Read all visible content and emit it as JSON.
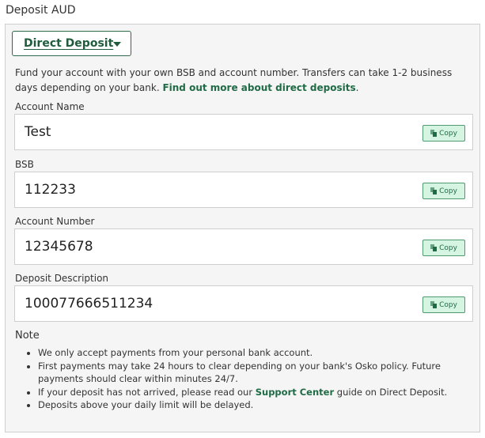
{
  "page_title": "Deposit AUD",
  "method_select": {
    "selected": "Direct Deposit"
  },
  "intro": {
    "text": "Fund your account with your own BSB and account number. Transfers can take 1-2 business days depending on your bank. ",
    "link": "Find out more about direct deposits",
    "suffix": "."
  },
  "fields": [
    {
      "label": "Account Name",
      "value": "Test",
      "copy_label": "Copy"
    },
    {
      "label": "BSB",
      "value": "112233",
      "copy_label": "Copy"
    },
    {
      "label": "Account Number",
      "value": "12345678",
      "copy_label": "Copy"
    },
    {
      "label": "Deposit Description",
      "value": "100077666511234",
      "copy_label": "Copy"
    }
  ],
  "note": {
    "title": "Note",
    "items": [
      {
        "text": "We only accept payments from your personal bank account."
      },
      {
        "text": "First payments may take 24 hours to clear depending on your bank's Osko policy. Future payments should clear within minutes 24/7."
      },
      {
        "before": "If your deposit has not arrived, please read our ",
        "link": "Support Center",
        "after": " guide on Direct Deposit."
      },
      {
        "text": "Deposits above your daily limit will be delayed."
      }
    ]
  },
  "colors": {
    "accent": "#1f5c3c",
    "copy_button_bg": "#d6f4e2",
    "panel_bg": "#f5f5f5"
  },
  "icons": {
    "dropdown": "caret-down-icon",
    "copy": "copy-icon"
  }
}
